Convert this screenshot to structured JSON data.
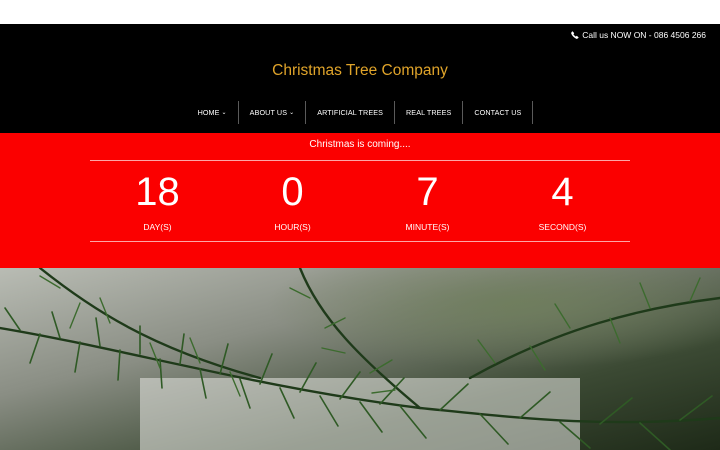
{
  "header": {
    "phone_icon": "phone-icon",
    "phone_text": "Call us NOW ON - 086 4506 266",
    "brand": "Christmas Tree Company",
    "brand_color": "#e0a42a",
    "background": "#000000"
  },
  "nav": {
    "items": [
      {
        "label": "HOME",
        "dropdown": true
      },
      {
        "label": "ABOUT US",
        "dropdown": true
      },
      {
        "label": "ARTIFICIAL TREES",
        "dropdown": false
      },
      {
        "label": "REAL TREES",
        "dropdown": false
      },
      {
        "label": "CONTACT US",
        "dropdown": false
      }
    ]
  },
  "countdown": {
    "title": "Christmas is coming....",
    "background": "#fb0000",
    "units": [
      {
        "value": "18",
        "label": "DAY(S)"
      },
      {
        "value": "0",
        "label": "HOUR(S)"
      },
      {
        "value": "7",
        "label": "MINUTE(S)"
      },
      {
        "value": "4",
        "label": "SECOND(S)"
      }
    ]
  },
  "hero": {
    "image": "pine-branches-photo"
  }
}
